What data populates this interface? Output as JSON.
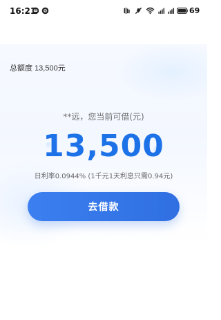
{
  "status_bar": {
    "time": "16:21",
    "battery": "69"
  },
  "account": {
    "total_label": "总额度 13,500元"
  },
  "main": {
    "subtitle": "**远，您当前可借(元)",
    "amount": "13,500",
    "rate_text": "日利率0.0944% (1千元1天利息只需0.94元)",
    "cta_label": "去借款"
  },
  "colors": {
    "primary": "#1D72E8",
    "button": "#3B7FF0"
  },
  "icons": {
    "status_left": [
      "message-icon",
      "browser-icon"
    ],
    "status_right": [
      "mute-icon",
      "do-not-disturb-icon",
      "wifi-icon",
      "signal-icon",
      "battery-icon"
    ]
  }
}
